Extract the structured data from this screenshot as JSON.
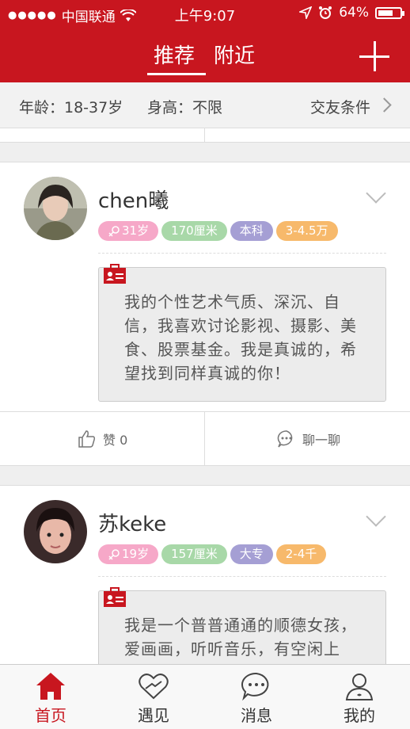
{
  "status_bar": {
    "signal_dots": "●●●●●",
    "carrier": "中国联通",
    "time": "上午9:07",
    "battery_percent": "64%",
    "battery_level": 0.64
  },
  "header": {
    "tab_recommend": "推荐",
    "tab_nearby": "附近"
  },
  "filter": {
    "age": "年龄：18-37岁",
    "height": "身高：不限",
    "conditions": "交友条件"
  },
  "cards": [
    {
      "name": "chen曦",
      "age": "31岁",
      "height": "170厘米",
      "education": "本科",
      "income": "3-4.5万",
      "bio": "我的个性艺术气质、深沉、自信，我喜欢讨论影视、摄影、美食、股票基金。我是真诚的，希望找到同样真诚的你！",
      "like_label": "赞 0",
      "chat_label": "聊一聊"
    },
    {
      "name": "苏keke",
      "age": "19岁",
      "height": "157厘米",
      "education": "大专",
      "income": "2-4千",
      "bio": "我是一个普普通通的顺德女孩，爱画画，听听音乐，有空闲上"
    }
  ],
  "bottom_nav": [
    {
      "label": "首页",
      "icon": "home-icon",
      "active": true
    },
    {
      "label": "遇见",
      "icon": "heart-hands-icon",
      "active": false
    },
    {
      "label": "消息",
      "icon": "chat-bubble-icon",
      "active": false
    },
    {
      "label": "我的",
      "icon": "user-icon",
      "active": false
    }
  ],
  "colors": {
    "brand_red": "#c8161f",
    "tag_pink": "#f6a8c8",
    "tag_green": "#a8d8a8",
    "tag_purple": "#a59fd4",
    "tag_orange": "#f7b96b"
  }
}
